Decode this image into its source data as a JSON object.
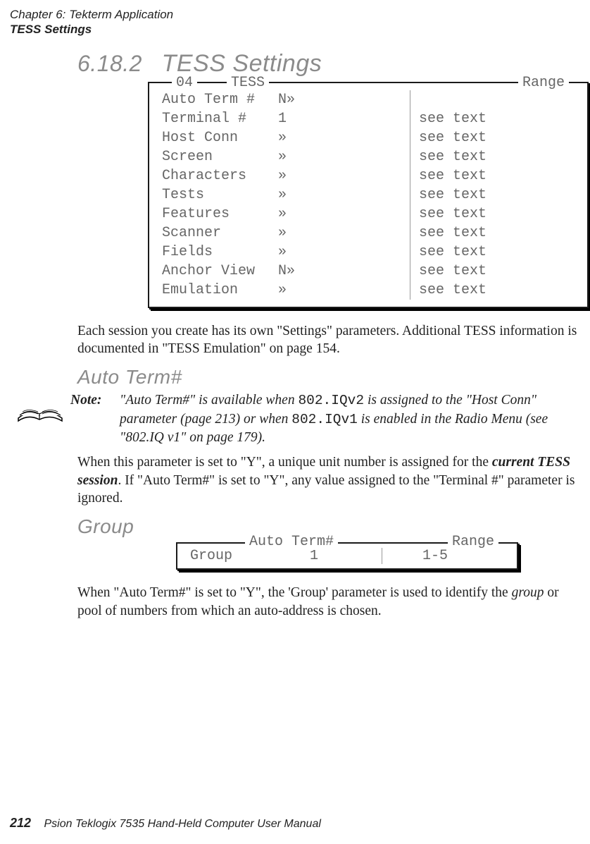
{
  "header": {
    "chapter_line": "Chapter 6: Tekterm Application",
    "section_line": "TESS Settings"
  },
  "section": {
    "number": "6.18.2",
    "title": "TESS Settings"
  },
  "tess_box": {
    "label04": "04",
    "labelTess": "TESS",
    "labelRange": "Range",
    "rows": [
      {
        "name": "Auto Term #",
        "val": "N»",
        "range": ""
      },
      {
        "name": "Terminal #",
        "val": "1",
        "range": "see text"
      },
      {
        "name": "Host Conn",
        "val": "»",
        "range": "see text"
      },
      {
        "name": "Screen",
        "val": "»",
        "range": "see text"
      },
      {
        "name": "Characters",
        "val": "»",
        "range": "see text"
      },
      {
        "name": "Tests",
        "val": "»",
        "range": "see text"
      },
      {
        "name": "Features",
        "val": "»",
        "range": "see text"
      },
      {
        "name": "Scanner",
        "val": "»",
        "range": "see text"
      },
      {
        "name": "Fields",
        "val": "»",
        "range": "see text"
      },
      {
        "name": "Anchor View",
        "val": "N»",
        "range": "see text"
      },
      {
        "name": "Emulation",
        "val": "»",
        "range": "see text"
      }
    ]
  },
  "para_session": "Each session you create has its own \"Settings\" parameters. Additional TESS information is documented in \"TESS Emulation\" on page 154.",
  "auto_term_heading": "Auto Term#",
  "note": {
    "label": "Note:",
    "text_prefix": "\"Auto Term#\" is available when ",
    "code1": "802.IQv2",
    "text_mid1": " is assigned to the \"Host Conn\" parameter (page 213) or when ",
    "code2": "802.IQv1",
    "text_mid2": " is enabled in the Radio Menu (see \"802.IQ v1\" on page 179)."
  },
  "para_auto_term": {
    "prefix": "When this parameter is set to \"Y\", a unique unit number is assigned for the ",
    "bolditalic": "current TESS session",
    "suffix": ". If \"Auto Term#\" is set to \"Y\", any value assigned to the \"Terminal #\" parameter is ignored."
  },
  "group_heading": "Group",
  "group_box": {
    "labelAuto": "Auto Term#",
    "labelRange": "Range",
    "name": "Group",
    "val": "1",
    "range": "1-5"
  },
  "para_group": {
    "prefix": "When \"Auto Term#\" is set to \"Y\", the 'Group' parameter is used to identify the ",
    "italic": "group",
    "suffix": " or pool of numbers from which an auto-address is chosen."
  },
  "footer": {
    "page": "212",
    "text": "Psion Teklogix 7535 Hand-Held Computer User Manual"
  }
}
